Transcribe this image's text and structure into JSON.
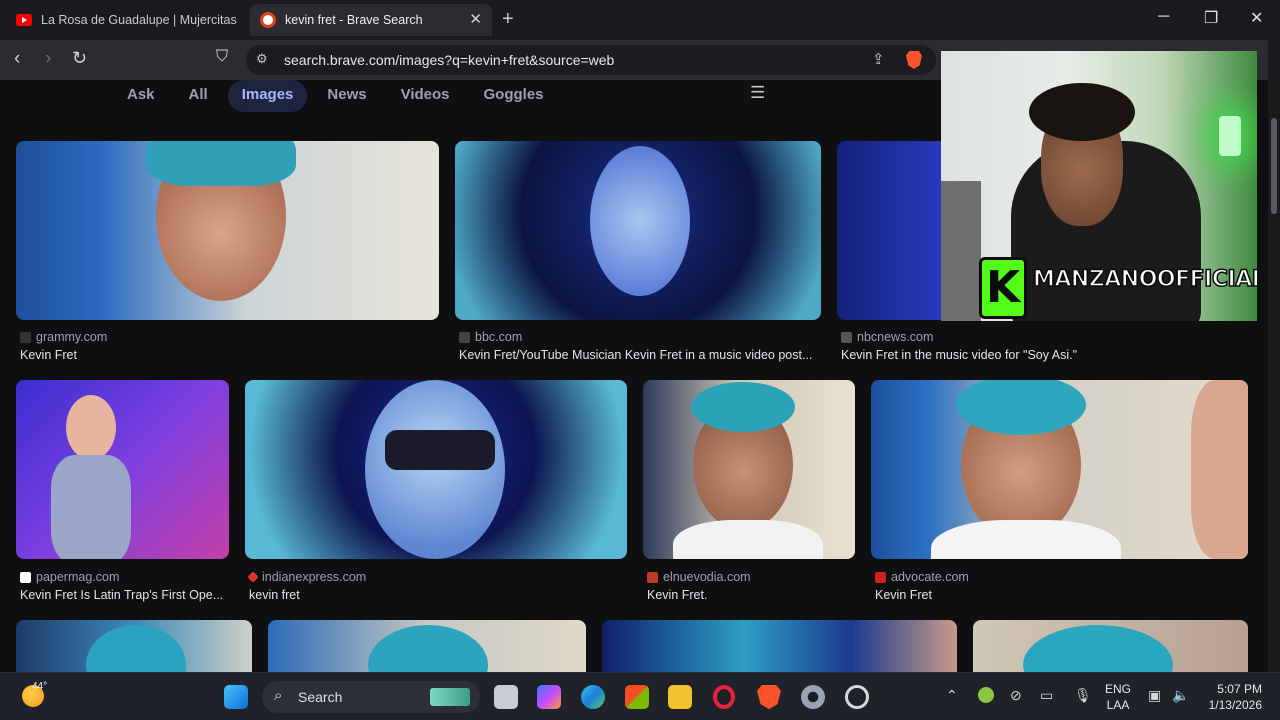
{
  "tabs": [
    {
      "title": "La Rosa de Guadalupe | Mujercitas [P"
    },
    {
      "title": "kevin fret - Brave Search"
    }
  ],
  "address": {
    "url": "search.brave.com/images?q=kevin+fret&source=web"
  },
  "filters": [
    "Ask",
    "All",
    "Images",
    "News",
    "Videos",
    "Goggles"
  ],
  "active_filter": "Images",
  "row1": [
    {
      "source": "grammy.com",
      "title": "Kevin Fret"
    },
    {
      "source": "bbc.com",
      "title": "Kevin Fret/YouTube Musician Kevin Fret in a music video post..."
    },
    {
      "source": "nbcnews.com",
      "title": "Kevin Fret in the music video for \"Soy Asi.\""
    }
  ],
  "row2": [
    {
      "source": "papermag.com",
      "title": "Kevin Fret Is Latin Trap's First Ope..."
    },
    {
      "source": "indianexpress.com",
      "title": "kevin fret"
    },
    {
      "source": "elnuevodia.com",
      "title": "Kevin Fret."
    },
    {
      "source": "advocate.com",
      "title": "Kevin Fret"
    }
  ],
  "webcam": {
    "overlay_text": "MANZANOOFFICIAL",
    "logo_letter": "K"
  },
  "taskbar": {
    "temperature": "44°",
    "search_label": "Search",
    "language_1": "ENG",
    "language_2": "LAA",
    "time": "5:07 PM",
    "date": "1/13/2026"
  },
  "colors": {
    "accent": "#a9b5ff",
    "brave_orange": "#fb542b",
    "kick_green": "#53fc18"
  },
  "icons": [
    "youtube-icon",
    "brave-icon",
    "close-icon",
    "plus-icon",
    "back-icon",
    "forward-icon",
    "reload-icon",
    "bookmark-icon",
    "site-info-icon",
    "share-icon",
    "settings-sliders-icon",
    "windows-icon",
    "search-icon"
  ]
}
